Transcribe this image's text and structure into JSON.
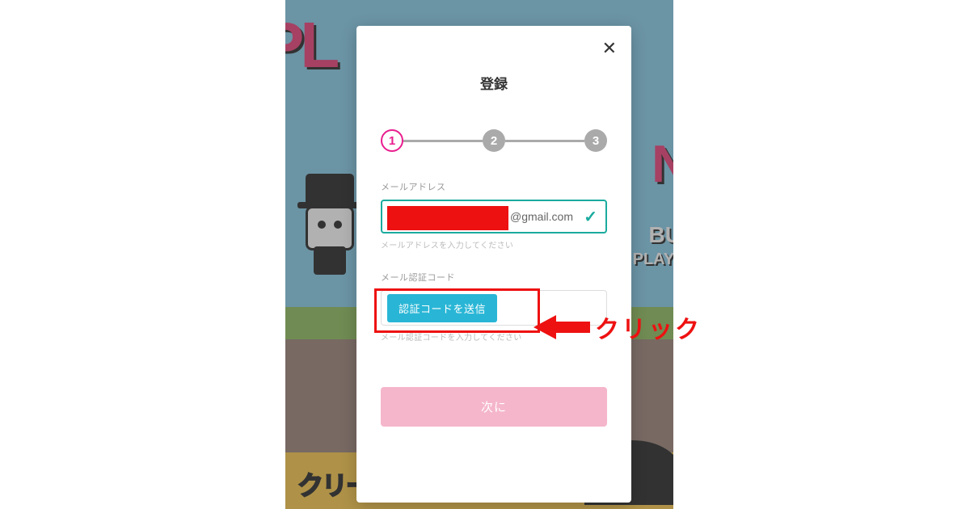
{
  "modal": {
    "title": "登録",
    "close_label": "✕"
  },
  "stepper": {
    "step1": "1",
    "step2": "2",
    "step3": "3"
  },
  "email": {
    "label": "メールアドレス",
    "visible_part": "@gmail.com",
    "helper": "メールアドレスを入力してください"
  },
  "code": {
    "label": "メール認証コード",
    "send_button": "認証コードを送信",
    "helper": "メール認証コードを入力してください"
  },
  "next_button": "次に",
  "annotation": {
    "click_text": "クリック"
  },
  "background": {
    "top_text": "PL",
    "right_n": "N",
    "bu_text": "BU",
    "play_text": "PLAYW",
    "bottom_text": "クリーンプロモーション"
  }
}
